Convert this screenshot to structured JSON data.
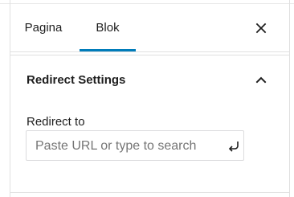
{
  "tabs": [
    {
      "label": "Pagina",
      "active": false
    },
    {
      "label": "Blok",
      "active": true
    }
  ],
  "close_icon": "close-icon",
  "panel": {
    "title": "Redirect Settings",
    "expanded": true,
    "toggle_icon": "chevron-up-icon"
  },
  "redirect_field": {
    "label": "Redirect to",
    "value": "",
    "placeholder": "Paste URL or type to search",
    "submit_icon": "keyboard-return-icon"
  },
  "colors": {
    "accent": "#007cba",
    "text": "#1e1e1e",
    "placeholder": "#757575",
    "border": "#dcdcde"
  }
}
